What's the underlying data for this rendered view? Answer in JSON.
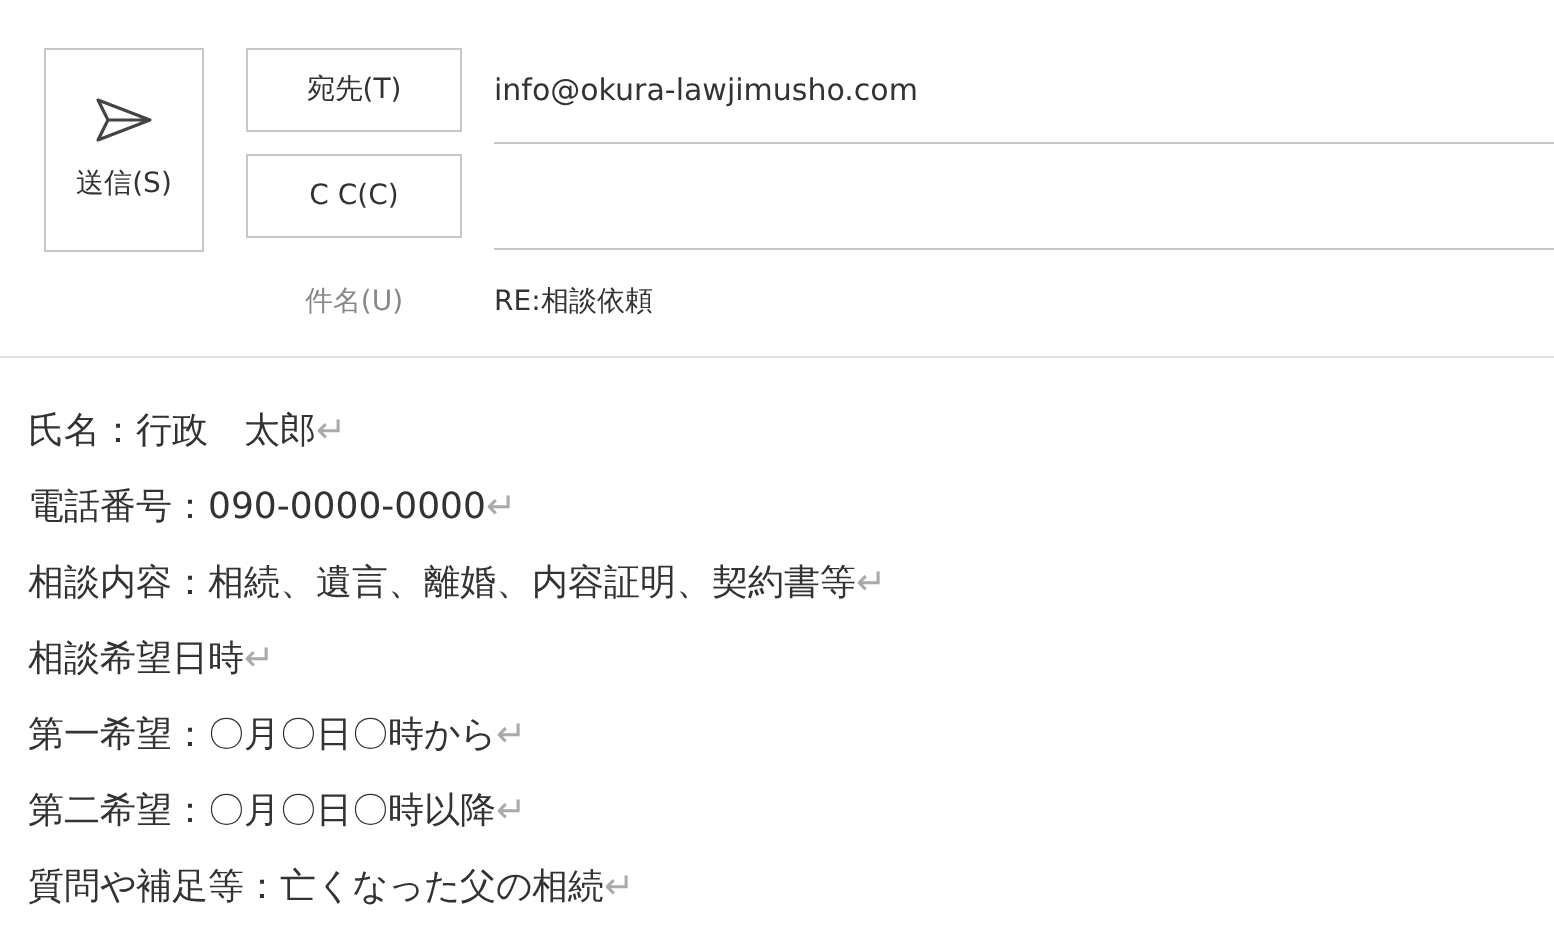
{
  "send_button": {
    "label": "送信(S)"
  },
  "to": {
    "button": "宛先(T)",
    "value": "info@okura-lawjimusho.com"
  },
  "cc": {
    "button": "C C(C)"
  },
  "subject": {
    "label": "件名(U)",
    "value": "RE:相談依頼"
  },
  "body": [
    {
      "text": "氏名：行政　太郎",
      "mark": "↵"
    },
    {
      "text": "電話番号：090-0000-0000",
      "mark": "↵"
    },
    {
      "text": "相談内容：相続、遺言、離婚、内容証明、契約書等",
      "mark": "↵"
    },
    {
      "text": "相談希望日時",
      "mark": "↵"
    },
    {
      "text": "第一希望：〇月〇日〇時から",
      "mark": "↵"
    },
    {
      "text": "第二希望：〇月〇日〇時以降",
      "mark": "↵"
    },
    {
      "text": "質問や補足等：亡くなった父の相続",
      "mark": "↵"
    }
  ]
}
